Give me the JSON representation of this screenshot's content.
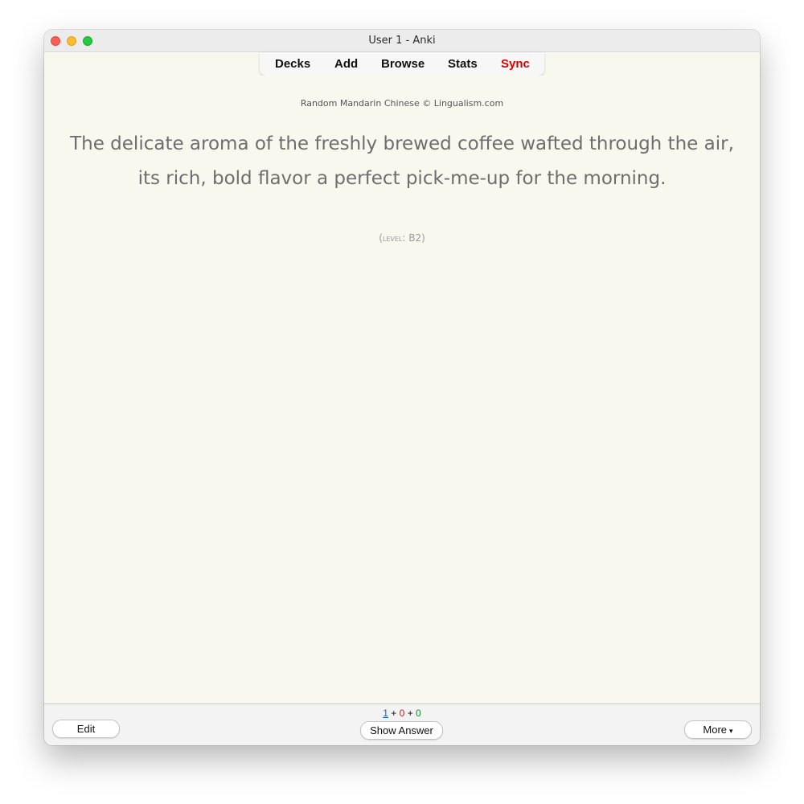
{
  "window": {
    "title": "User 1 - Anki"
  },
  "toolbar": {
    "items": [
      "Decks",
      "Add",
      "Browse",
      "Stats",
      "Sync"
    ]
  },
  "card": {
    "attribution": "Random Mandarin Chinese © Lingualism.com",
    "sentence": "The delicate aroma of the freshly brewed coffee wafted through the air, its rich, bold flavor a perfect pick-me-up for the morning.",
    "level_label": "level",
    "level_value": "B2"
  },
  "bottom": {
    "counts": {
      "new": "1",
      "learning": "0",
      "review": "0",
      "separator": "+"
    },
    "edit_label": "Edit",
    "show_answer_label": "Show Answer",
    "more_label": "More",
    "more_icon": "chevron-down-icon"
  },
  "colors": {
    "sync": "#d70000",
    "count_new": "#1f5dc9",
    "count_learning": "#c51b1b",
    "count_review": "#138a2b",
    "card_background": "#f8f8ee"
  }
}
